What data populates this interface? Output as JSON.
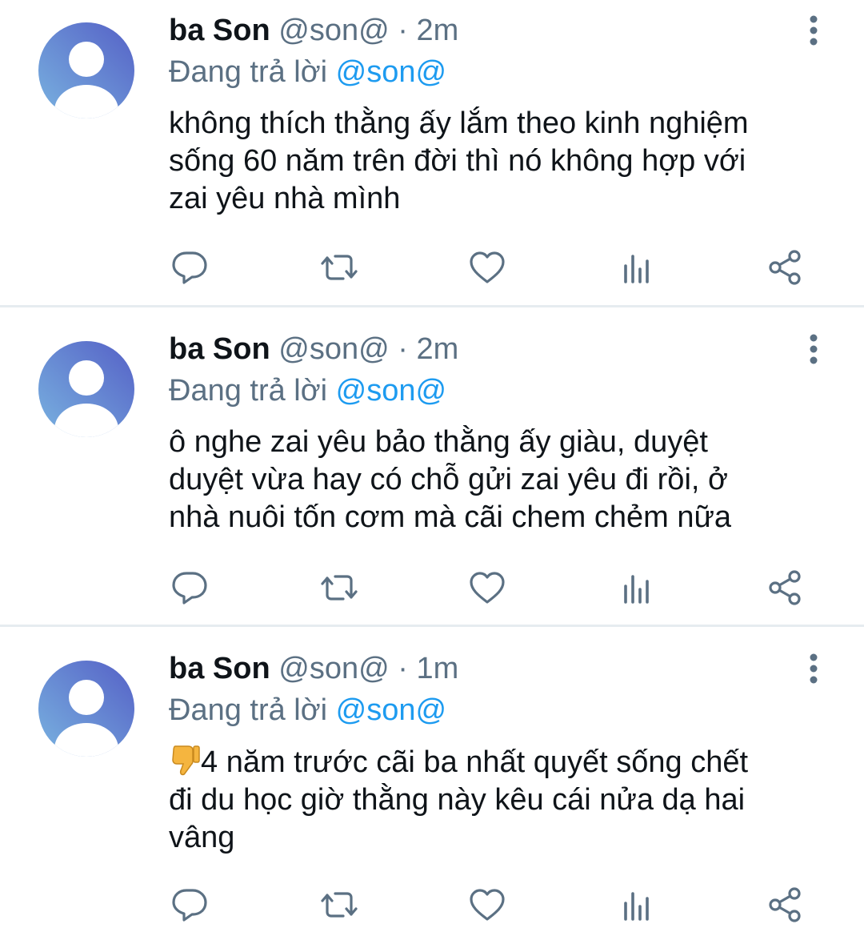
{
  "tweets": [
    {
      "name": "ba Son",
      "meta": "@son@ · 2m",
      "reply_prefix": "Đang trả lời",
      "reply_to": "@son@",
      "text": "không thích thằng ấy lắm theo kinh nghiệm\nsống 60 năm trên đời thì nó không hợp với\nzai yêu nhà mình"
    },
    {
      "name": "ba Son",
      "meta": "@son@ · 2m",
      "reply_prefix": "Đang trả lời",
      "reply_to": "@son@",
      "text": "ô nghe zai yêu bảo thằng ấy giàu, duyệt\nduyệt vừa hay có chỗ gửi zai yêu đi rồi, ở\nnhà nuôi tốn cơm mà cãi chem chẻm nữa"
    },
    {
      "name": "ba Son",
      "meta": "@son@ · 1m",
      "reply_prefix": "Đang trả lời",
      "reply_to": "@son@",
      "emoji": "thumbs-down-emoji",
      "text": "4 năm trước cãi ba nhất quyết sống chết\nđi du học giờ thằng này kêu cái nửa dạ hai\nvâng"
    }
  ],
  "icons": {
    "avatar": "default-avatar-icon",
    "more": "more-vertical-icon",
    "reply": "reply-icon",
    "retweet": "retweet-icon",
    "like": "heart-icon",
    "analytics": "analytics-icon",
    "share": "share-icon"
  },
  "colors": {
    "text": "#0f1419",
    "secondary": "#5b7083",
    "accent": "#1d9bf0",
    "avatar_gradient_start": "#6fa8dc",
    "avatar_gradient_end": "#5b6bc9",
    "divider": "#e6ecf0"
  }
}
